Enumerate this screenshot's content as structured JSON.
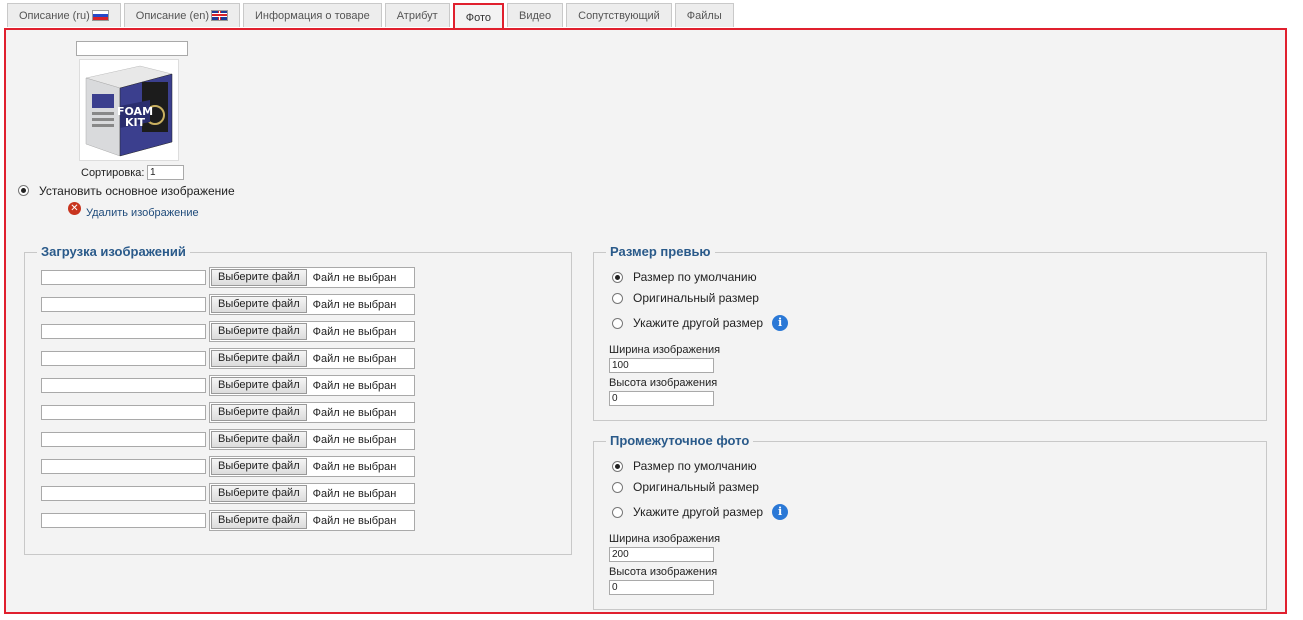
{
  "tabs": [
    {
      "label": "Описание (ru)",
      "flag": "ru-flag-icon"
    },
    {
      "label": "Описание (en)",
      "flag": "uk-flag-icon"
    },
    {
      "label": "Информация о товаре"
    },
    {
      "label": "Атрибут"
    },
    {
      "label": "Фото",
      "active": true
    },
    {
      "label": "Видео"
    },
    {
      "label": "Сопутствующий"
    },
    {
      "label": "Файлы"
    }
  ],
  "image_block": {
    "caption_value": "",
    "product_image_text": "FOAM KIT",
    "sort_label": "Сортировка:",
    "sort_value": "1",
    "main_image_label": "Установить основное изображение",
    "delete_label": "Удалить изображение"
  },
  "upload": {
    "legend": "Загрузка изображений",
    "button_label": "Выберите файл",
    "status_text": "Файл не выбран",
    "rows": 10
  },
  "preview_size": {
    "legend": "Размер превью",
    "options": [
      "Размер по умолчанию",
      "Оригинальный размер",
      "Укажите другой размер"
    ],
    "selected": 0,
    "width_label": "Ширина изображения",
    "width_value": "100",
    "height_label": "Высота изображения",
    "height_value": "0"
  },
  "intermediate": {
    "legend": "Промежуточное фото",
    "options": [
      "Размер по умолчанию",
      "Оригинальный размер",
      "Укажите другой размер"
    ],
    "selected": 0,
    "width_label": "Ширина изображения",
    "width_value": "200",
    "height_label": "Высота изображения",
    "height_value": "0"
  },
  "colors": {
    "accent_border": "#e0202e",
    "legend_text": "#2a5a8a",
    "info_icon": "#2a78d6",
    "delete_icon": "#c8341e"
  }
}
